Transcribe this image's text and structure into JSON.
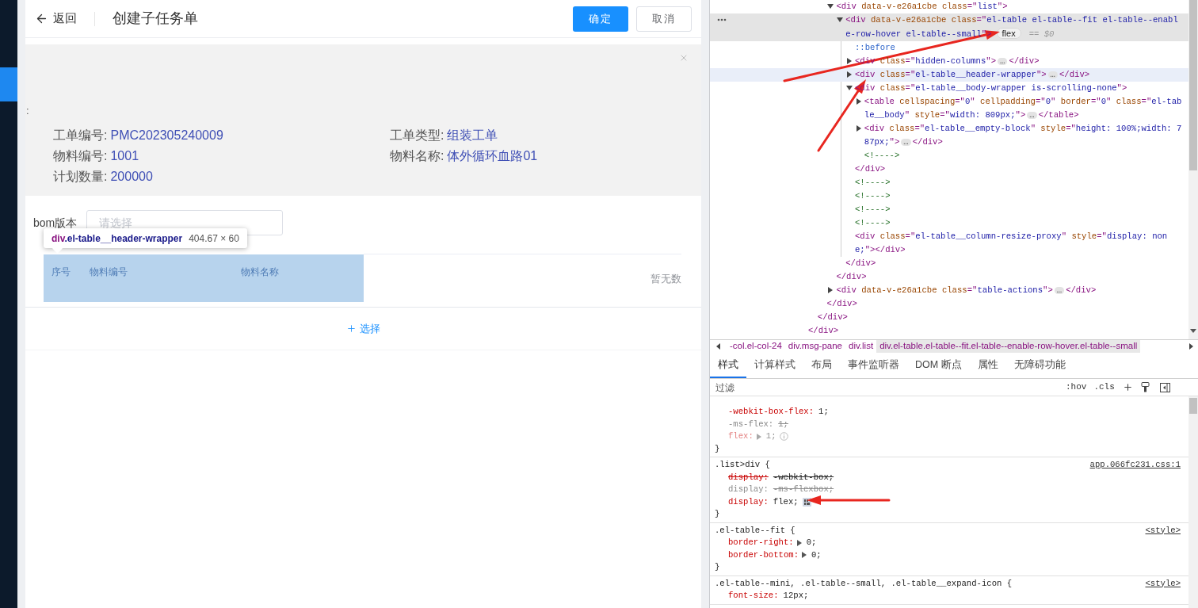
{
  "app": {
    "back": "返回",
    "title": "创建子任务单",
    "buttons": [
      {
        "label": "确定",
        "kind": "primary"
      },
      {
        "label": "取消",
        "kind": "default"
      }
    ],
    "info_panel": {
      "marker": ":",
      "fields": [
        {
          "label": "工单编号:",
          "value": "PMC202305240009"
        },
        {
          "label": "工单类型:",
          "value": "组装工单"
        },
        {
          "label": "物料编号:",
          "value": "1001"
        },
        {
          "label": "物料名称:",
          "value": "体外循环血路01"
        },
        {
          "label": "计划数量:",
          "value": "200000"
        }
      ]
    },
    "bom": {
      "label": "bom版本",
      "placeholder": "请选择"
    },
    "table": {
      "columns": [
        "序号",
        "物料编号",
        "物料名称"
      ],
      "empty_text": "暂无数"
    },
    "add_button": {
      "label": "选择"
    }
  },
  "inspect_tooltip": {
    "tag": "div",
    "class": ".el-table__header-wrapper",
    "size": "404.67 × 60"
  },
  "devtools": {
    "dom": [
      {
        "children": [
          {
            "children": [
              {
                "children": [
                  {
                    "kind": "element",
                    "expanded": true,
                    "selected": false,
                    "hovered": false,
                    "s": [
                      {
                        "kind": "tag",
                        "text": "<div "
                      },
                      {
                        "kind": "attr",
                        "text": "data-v-e26a1cbe class"
                      },
                      {
                        "kind": "tag",
                        "text": "=\""
                      },
                      {
                        "kind": "value",
                        "text": "list"
                      },
                      {
                        "kind": "tag",
                        "text": "\">"
                      }
                    ],
                    "children": [
                      {
                        "kind": "element",
                        "expanded": true,
                        "selected": true,
                        "hovered": false,
                        "s": [
                          {
                            "kind": "tag",
                            "text": "<div "
                          },
                          {
                            "kind": "attr",
                            "text": "data-v-e26a1cbe class"
                          },
                          {
                            "kind": "tag",
                            "text": "=\""
                          },
                          {
                            "kind": "value",
                            "text": "el-table el-table--fit el-table--enable-row-hover el-table--small"
                          },
                          {
                            "kind": "tag",
                            "text": "\">"
                          },
                          {
                            "kind": "badge",
                            "text": "flex"
                          },
                          {
                            "kind": "hint",
                            "text": "== $0"
                          }
                        ],
                        "children": [
                          {
                            "kind": "leaf",
                            "selected": false,
                            "hovered": false,
                            "s": [
                              {
                                "kind": "pseudo",
                                "text": "::before"
                              }
                            ]
                          },
                          {
                            "kind": "element",
                            "expanded": false,
                            "selected": false,
                            "hovered": false,
                            "s": [
                              {
                                "kind": "tag",
                                "text": "<div "
                              },
                              {
                                "kind": "attr",
                                "text": "class"
                              },
                              {
                                "kind": "tag",
                                "text": "=\""
                              },
                              {
                                "kind": "value",
                                "text": "hidden-columns"
                              },
                              {
                                "kind": "tag",
                                "text": "\">"
                              },
                              {
                                "kind": "ellipsis",
                                "text": "…"
                              },
                              {
                                "kind": "tag",
                                "text": "</div>"
                              }
                            ]
                          },
                          {
                            "kind": "element",
                            "expanded": false,
                            "selected": false,
                            "hovered": true,
                            "s": [
                              {
                                "kind": "tag",
                                "text": "<div "
                              },
                              {
                                "kind": "attr",
                                "text": "class"
                              },
                              {
                                "kind": "tag",
                                "text": "=\""
                              },
                              {
                                "kind": "value",
                                "text": "el-table__header-wrapper"
                              },
                              {
                                "kind": "tag",
                                "text": "\">"
                              },
                              {
                                "kind": "ellipsis",
                                "text": "…"
                              },
                              {
                                "kind": "tag",
                                "text": "</div>"
                              }
                            ]
                          },
                          {
                            "kind": "element",
                            "expanded": true,
                            "selected": false,
                            "hovered": false,
                            "s": [
                              {
                                "kind": "tag",
                                "text": "<div "
                              },
                              {
                                "kind": "attr",
                                "text": "class"
                              },
                              {
                                "kind": "tag",
                                "text": "=\""
                              },
                              {
                                "kind": "value",
                                "text": "el-table__body-wrapper is-scrolling-none"
                              },
                              {
                                "kind": "tag",
                                "text": "\">"
                              }
                            ],
                            "children": [
                              {
                                "kind": "element",
                                "expanded": false,
                                "selected": false,
                                "hovered": false,
                                "s": [
                                  {
                                    "kind": "tag",
                                    "text": "<table "
                                  },
                                  {
                                    "kind": "attr",
                                    "text": "cellspacing"
                                  },
                                  {
                                    "kind": "tag",
                                    "text": "=\""
                                  },
                                  {
                                    "kind": "value",
                                    "text": "0"
                                  },
                                  {
                                    "kind": "tag",
                                    "text": "\" "
                                  },
                                  {
                                    "kind": "attr",
                                    "text": "cellpadding"
                                  },
                                  {
                                    "kind": "tag",
                                    "text": "=\""
                                  },
                                  {
                                    "kind": "value",
                                    "text": "0"
                                  },
                                  {
                                    "kind": "tag",
                                    "text": "\" "
                                  },
                                  {
                                    "kind": "attr",
                                    "text": "border"
                                  },
                                  {
                                    "kind": "tag",
                                    "text": "=\""
                                  },
                                  {
                                    "kind": "value",
                                    "text": "0"
                                  },
                                  {
                                    "kind": "tag",
                                    "text": "\" "
                                  },
                                  {
                                    "kind": "attr",
                                    "text": "class"
                                  },
                                  {
                                    "kind": "tag",
                                    "text": "=\""
                                  },
                                  {
                                    "kind": "value",
                                    "text": "el-table__body"
                                  },
                                  {
                                    "kind": "tag",
                                    "text": "\" "
                                  },
                                  {
                                    "kind": "attr",
                                    "text": "style"
                                  },
                                  {
                                    "kind": "tag",
                                    "text": "=\""
                                  },
                                  {
                                    "kind": "value",
                                    "text": "width: 809px;"
                                  },
                                  {
                                    "kind": "tag",
                                    "text": "\">"
                                  },
                                  {
                                    "kind": "ellipsis",
                                    "text": "…"
                                  },
                                  {
                                    "kind": "tag",
                                    "text": "</table>"
                                  }
                                ]
                              },
                              {
                                "kind": "element",
                                "expanded": false,
                                "selected": false,
                                "hovered": false,
                                "s": [
                                  {
                                    "kind": "tag",
                                    "text": "<div "
                                  },
                                  {
                                    "kind": "attr",
                                    "text": "class"
                                  },
                                  {
                                    "kind": "tag",
                                    "text": "=\""
                                  },
                                  {
                                    "kind": "value",
                                    "text": "el-table__empty-block"
                                  },
                                  {
                                    "kind": "tag",
                                    "text": "\" "
                                  },
                                  {
                                    "kind": "attr",
                                    "text": "style"
                                  },
                                  {
                                    "kind": "tag",
                                    "text": "=\""
                                  },
                                  {
                                    "kind": "value",
                                    "text": "height: 100%;width: 787px;"
                                  },
                                  {
                                    "kind": "tag",
                                    "text": "\">"
                                  },
                                  {
                                    "kind": "ellipsis",
                                    "text": "…"
                                  },
                                  {
                                    "kind": "tag",
                                    "text": "</div>"
                                  }
                                ]
                              },
                              {
                                "kind": "leaf",
                                "selected": false,
                                "hovered": false,
                                "s": [
                                  {
                                    "kind": "comment",
                                    "text": "<!---->"
                                  }
                                ]
                              }
                            ]
                          },
                          {
                            "kind": "leaf",
                            "selected": false,
                            "hovered": false,
                            "s": [
                              {
                                "kind": "tag",
                                "text": "</div>"
                              }
                            ]
                          },
                          {
                            "kind": "leaf",
                            "selected": false,
                            "hovered": false,
                            "s": [
                              {
                                "kind": "comment",
                                "text": "<!---->"
                              }
                            ]
                          },
                          {
                            "kind": "leaf",
                            "selected": false,
                            "hovered": false,
                            "s": [
                              {
                                "kind": "comment",
                                "text": "<!---->"
                              }
                            ]
                          },
                          {
                            "kind": "leaf",
                            "selected": false,
                            "hovered": false,
                            "s": [
                              {
                                "kind": "comment",
                                "text": "<!---->"
                              }
                            ]
                          },
                          {
                            "kind": "leaf",
                            "selected": false,
                            "hovered": false,
                            "s": [
                              {
                                "kind": "comment",
                                "text": "<!---->"
                              }
                            ]
                          },
                          {
                            "kind": "leaf",
                            "selected": false,
                            "hovered": false,
                            "s": [
                              {
                                "kind": "tag",
                                "text": "<div "
                              },
                              {
                                "kind": "attr",
                                "text": "class"
                              },
                              {
                                "kind": "tag",
                                "text": "=\""
                              },
                              {
                                "kind": "value",
                                "text": "el-table__column-resize-proxy"
                              },
                              {
                                "kind": "tag",
                                "text": "\" "
                              },
                              {
                                "kind": "attr",
                                "text": "style"
                              },
                              {
                                "kind": "tag",
                                "text": "=\""
                              },
                              {
                                "kind": "value",
                                "text": "display: none;"
                              },
                              {
                                "kind": "tag",
                                "text": "\"></div>"
                              }
                            ]
                          }
                        ]
                      },
                      {
                        "kind": "leaf",
                        "selected": false,
                        "hovered": false,
                        "s": [
                          {
                            "kind": "tag",
                            "text": "</div>"
                          }
                        ]
                      }
                    ]
                  },
                  {
                    "kind": "leaf",
                    "selected": false,
                    "hovered": false,
                    "s": [
                      {
                        "kind": "tag",
                        "text": "</div>"
                      }
                    ]
                  },
                  {
                    "kind": "element",
                    "expanded": false,
                    "selected": false,
                    "hovered": false,
                    "s": [
                      {
                        "kind": "tag",
                        "text": "<div "
                      },
                      {
                        "kind": "attr",
                        "text": "data-v-e26a1cbe class"
                      },
                      {
                        "kind": "tag",
                        "text": "=\""
                      },
                      {
                        "kind": "value",
                        "text": "table-actions"
                      },
                      {
                        "kind": "tag",
                        "text": "\">"
                      },
                      {
                        "kind": "ellipsis",
                        "text": "…"
                      },
                      {
                        "kind": "tag",
                        "text": "</div>"
                      }
                    ]
                  }
                ]
              },
              {
                "kind": "leaf",
                "selected": false,
                "hovered": false,
                "s": [
                  {
                    "kind": "tag",
                    "text": "</div>"
                  }
                ]
              }
            ]
          },
          {
            "kind": "leaf",
            "selected": false,
            "hovered": false,
            "s": [
              {
                "kind": "tag",
                "text": "</div>"
              }
            ]
          }
        ]
      },
      {
        "kind": "leaf",
        "selected": false,
        "hovered": false,
        "s": [
          {
            "kind": "tag",
            "text": "</div>"
          }
        ]
      }
    ],
    "breadcrumbs": [
      {
        "text": "-col.el-col-24",
        "selected": false
      },
      {
        "text": "div.msg-pane",
        "selected": false
      },
      {
        "text": "div.list",
        "selected": false
      },
      {
        "text": "div.el-table.el-table--fit.el-table--enable-row-hover.el-table--small",
        "selected": true
      }
    ],
    "tabs": [
      {
        "label": "样式",
        "selected": true
      },
      {
        "label": "计算样式",
        "selected": false
      },
      {
        "label": "布局",
        "selected": false
      },
      {
        "label": "事件监听器",
        "selected": false
      },
      {
        "label": "DOM 断点",
        "selected": false
      },
      {
        "label": "属性",
        "selected": false
      },
      {
        "label": "无障碍功能",
        "selected": false
      }
    ],
    "filter": {
      "placeholder": "过滤",
      "buttons": [
        ":hov",
        ".cls"
      ]
    },
    "rules": [
      {
        "close": "}",
        "props": [
          {
            "name": "-webkit-box-flex:",
            "value": "1;",
            "kind": "active",
            "expandable": false,
            "info": false,
            "flex_editor": false
          },
          {
            "name": "-ms-flex:",
            "value": "1;",
            "kind": "invalid",
            "expandable": false,
            "info": false,
            "flex_editor": false
          },
          {
            "name": "flex:",
            "value": "1;",
            "kind": "inactive",
            "expandable": true,
            "info": true,
            "flex_editor": false
          }
        ]
      },
      {
        "selector": ".list>div {",
        "source": "app.066fc231.css:1",
        "close": "}",
        "props": [
          {
            "name": "display:",
            "value": "-webkit-box;",
            "kind": "overridden",
            "expandable": false,
            "info": false,
            "flex_editor": false
          },
          {
            "name": "display:",
            "value": "-ms-flexbox;",
            "kind": "invalid",
            "expandable": false,
            "info": false,
            "flex_editor": false
          },
          {
            "name": "display:",
            "value": "flex;",
            "kind": "active",
            "expandable": false,
            "info": false,
            "flex_editor": true
          }
        ]
      },
      {
        "selector": ".el-table--fit {",
        "source": "<style>",
        "close": "}",
        "props": [
          {
            "name": "border-right:",
            "value": "0;",
            "kind": "active",
            "expandable": true,
            "info": false,
            "flex_editor": false
          },
          {
            "name": "border-bottom:",
            "value": "0;",
            "kind": "active",
            "expandable": true,
            "info": false,
            "flex_editor": false
          }
        ]
      },
      {
        "selector": ".el-table--mini, .el-table--small, .el-table__expand-icon {",
        "source": "<style>",
        "props": [
          {
            "name": "font-size:",
            "value": "12px;",
            "kind": "active",
            "expandable": false,
            "info": false,
            "flex_editor": false
          }
        ]
      }
    ]
  },
  "annotations": [
    {
      "kind": "arrow"
    },
    {
      "kind": "arrow"
    },
    {
      "kind": "arrow"
    }
  ]
}
